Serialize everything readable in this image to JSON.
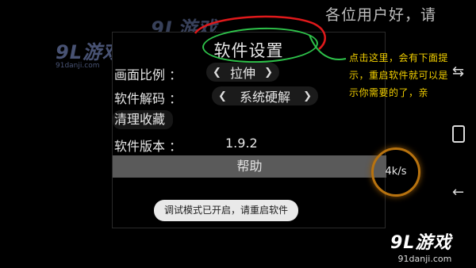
{
  "marquee": "各位用户好，请",
  "watermark": {
    "logo": "9L游戏",
    "sub": "91danji.com"
  },
  "dialog": {
    "title": "软件设置",
    "rows": {
      "aspect": {
        "label": "画面比例 ：",
        "value": "拉伸"
      },
      "decode": {
        "label": "软件解码 ：",
        "value": "系统硬解"
      },
      "clear": {
        "label": "清理收藏"
      },
      "version": {
        "label": "软件版本 ：",
        "value": "1.9.2"
      }
    },
    "help_label": "帮助",
    "toast": "调试模式已开启，请重启软件"
  },
  "speed": "4k/s",
  "annotation": {
    "line1": "点击这里，会有下面提",
    "line2": "示，重启软件就可以是",
    "line3": "示你需要的了，亲"
  },
  "colors": {
    "accent_ring": "#2ec24a",
    "annotation_text": "#f3d000",
    "annotation_arrow": "#e0191b",
    "speed_ring": "#b8730f"
  },
  "icons": {
    "nav_recent": "recent-apps-icon",
    "nav_home": "home-square-icon",
    "nav_back": "back-arrow-icon"
  }
}
